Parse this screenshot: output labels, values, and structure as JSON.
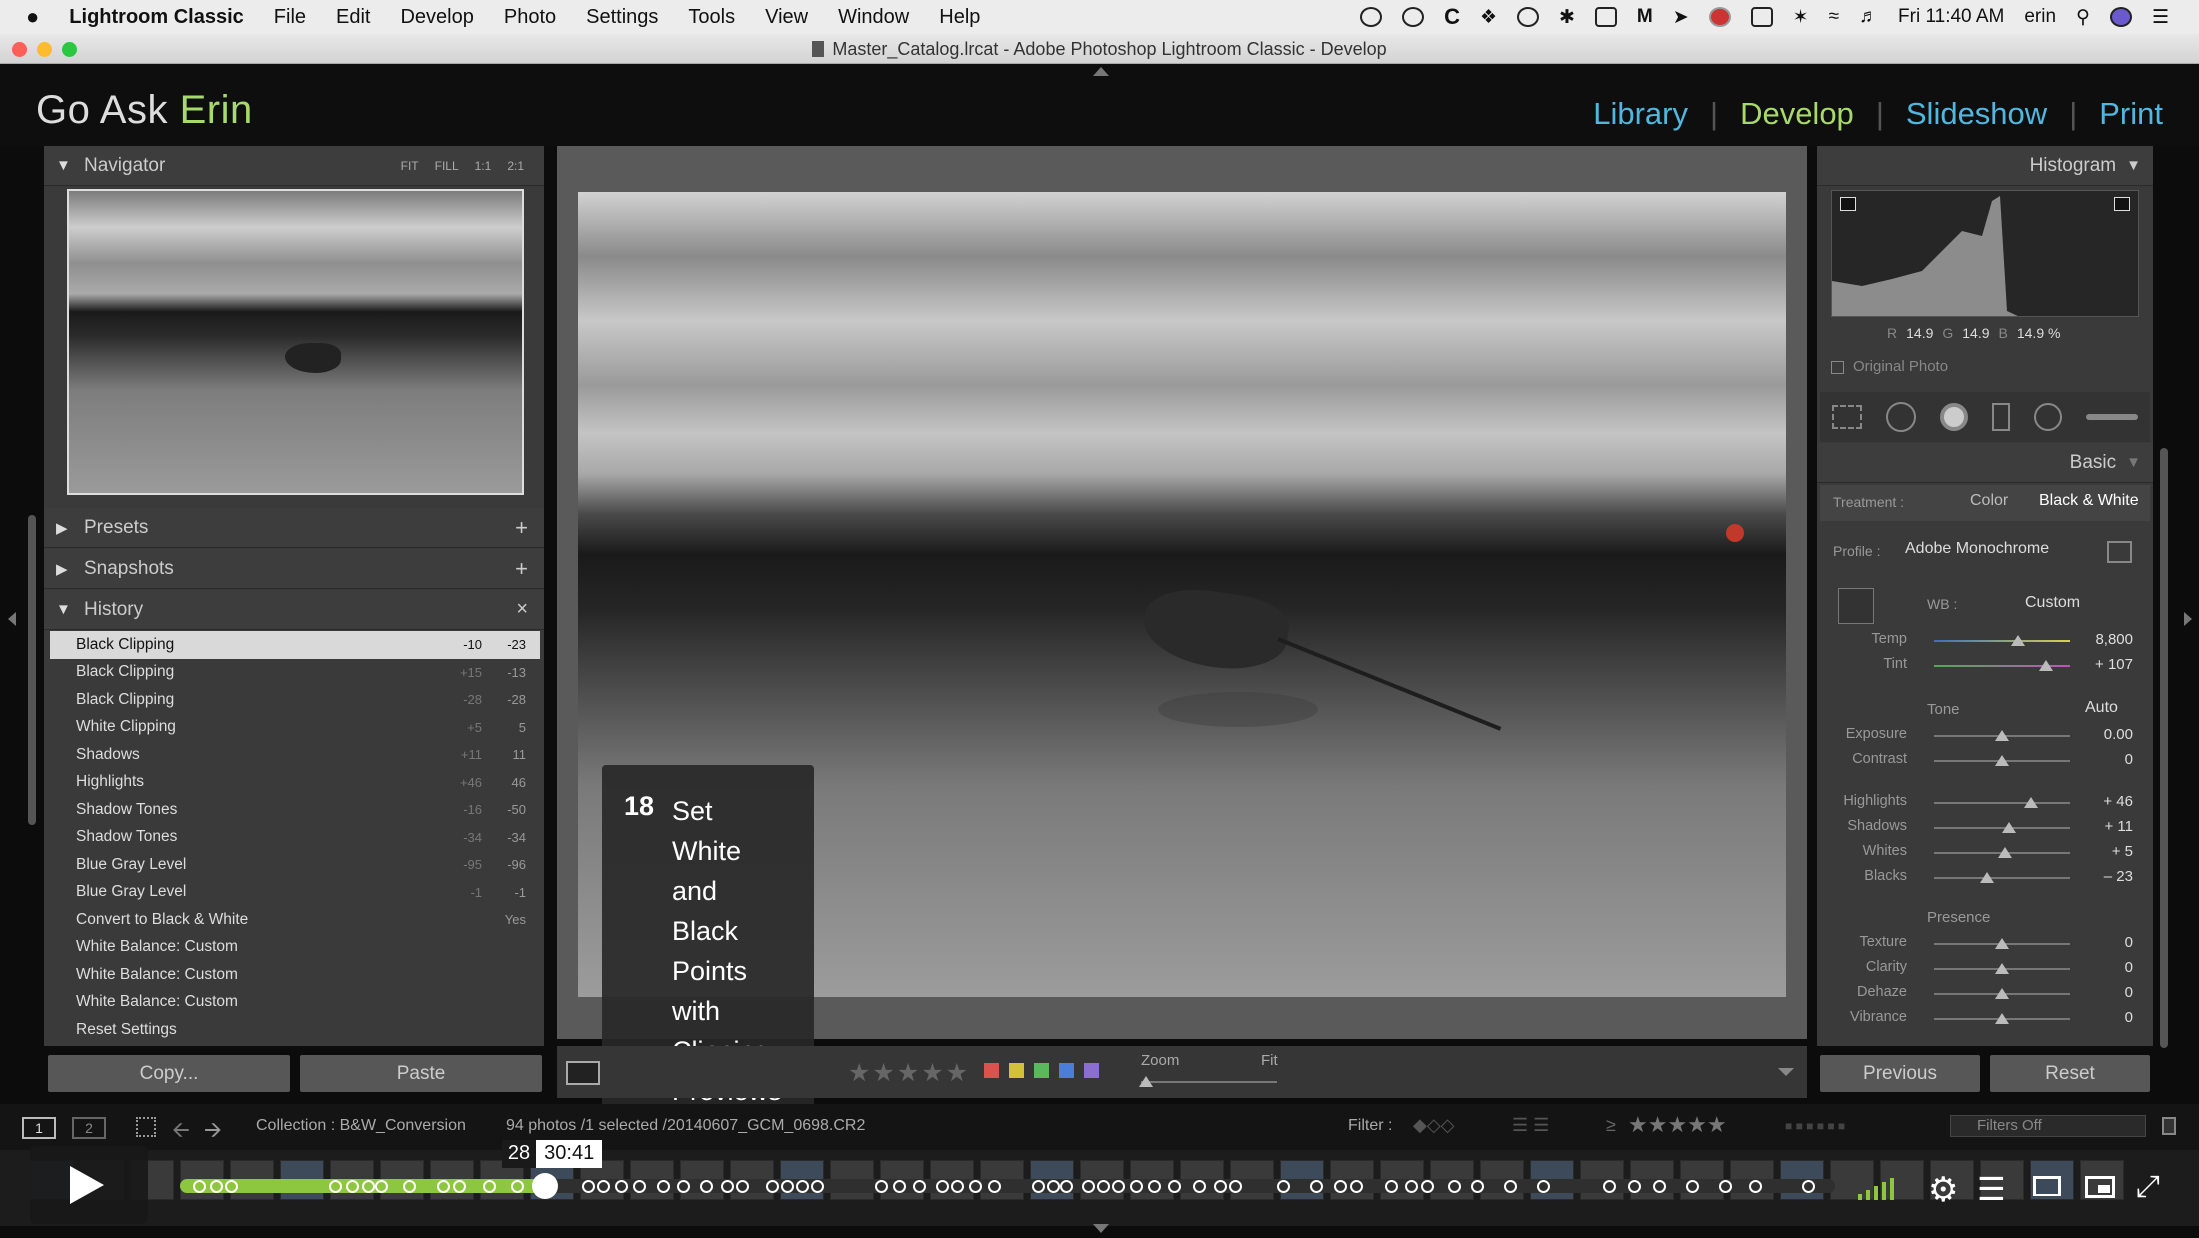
{
  "menubar": {
    "apple": "",
    "app_name": "Lightroom Classic",
    "menus": [
      "File",
      "Edit",
      "Develop",
      "Photo",
      "Settings",
      "Tools",
      "View",
      "Window",
      "Help"
    ],
    "clock": "Fri 11:40 AM",
    "user": "erin"
  },
  "window": {
    "title": "Master_Catalog.lrcat - Adobe Photoshop Lightroom Classic - Develop"
  },
  "brand": {
    "prefix": "Go Ask ",
    "highlight": "Erin"
  },
  "modules": [
    {
      "label": "Library",
      "color": "#4fb7e0"
    },
    {
      "label": "Develop",
      "color": "#a7d96b"
    },
    {
      "label": "Slideshow",
      "color": "#4fb7e0"
    },
    {
      "label": "Print",
      "color": "#4fb7e0"
    }
  ],
  "navigator": {
    "title": "Navigator",
    "zoom_options": [
      "FIT",
      "FILL",
      "1:1",
      "2:1"
    ]
  },
  "presets": {
    "title": "Presets"
  },
  "snapshots": {
    "title": "Snapshots"
  },
  "history": {
    "title": "History",
    "items": [
      {
        "label": "Black Clipping",
        "v1": "-10",
        "v2": "-23",
        "selected": true
      },
      {
        "label": "Black Clipping",
        "v1": "+15",
        "v2": "-13"
      },
      {
        "label": "Black Clipping",
        "v1": "-28",
        "v2": "-28"
      },
      {
        "label": "White Clipping",
        "v1": "+5",
        "v2": "5"
      },
      {
        "label": "Shadows",
        "v1": "+11",
        "v2": "11"
      },
      {
        "label": "Highlights",
        "v1": "+46",
        "v2": "46"
      },
      {
        "label": "Shadow Tones",
        "v1": "-16",
        "v2": "-50"
      },
      {
        "label": "Shadow Tones",
        "v1": "-34",
        "v2": "-34"
      },
      {
        "label": "Blue Gray Level",
        "v1": "-95",
        "v2": "-96"
      },
      {
        "label": "Blue Gray Level",
        "v1": "-1",
        "v2": "-1"
      },
      {
        "label": "Convert to Black & White",
        "v1": "",
        "v2": "Yes"
      },
      {
        "label": "White Balance: Custom",
        "v1": "",
        "v2": ""
      },
      {
        "label": "White Balance: Custom",
        "v1": "",
        "v2": ""
      },
      {
        "label": "White Balance: Custom",
        "v1": "",
        "v2": ""
      },
      {
        "label": "Reset Settings",
        "v1": "",
        "v2": ""
      }
    ]
  },
  "left_buttons": {
    "copy": "Copy...",
    "paste": "Paste"
  },
  "caption": {
    "number": "18",
    "lines": [
      "Set",
      "White",
      "and",
      "Black",
      "Points",
      "with",
      "Clipping",
      "Previews"
    ]
  },
  "toolbar": {
    "zoom_label": "Zoom",
    "fit_label": "Fit"
  },
  "histogram": {
    "title": "Histogram",
    "r_label": "R",
    "r": "14.9",
    "g_label": "G",
    "g": "14.9",
    "b_label": "B",
    "b": "14.9 %",
    "original_photo": "Original Photo"
  },
  "basic": {
    "title": "Basic",
    "treatment_label": "Treatment :",
    "treatment_color": "Color",
    "treatment_bw": "Black & White",
    "profile_label": "Profile :",
    "profile_value": "Adobe Monochrome",
    "wb_label": "WB :",
    "wb_value": "Custom",
    "temp": {
      "label": "Temp",
      "value": "8,800",
      "pos": 0.62
    },
    "tint": {
      "label": "Tint",
      "value": "+ 107",
      "pos": 0.82
    },
    "tone_label": "Tone",
    "auto_label": "Auto",
    "tone": [
      {
        "label": "Exposure",
        "value": "0.00",
        "pos": 0.5
      },
      {
        "label": "Contrast",
        "value": "0",
        "pos": 0.5
      }
    ],
    "tone2": [
      {
        "label": "Highlights",
        "value": "+ 46",
        "pos": 0.71
      },
      {
        "label": "Shadows",
        "value": "+ 11",
        "pos": 0.55
      },
      {
        "label": "Whites",
        "value": "+ 5",
        "pos": 0.52
      },
      {
        "label": "Blacks",
        "value": "– 23",
        "pos": 0.39
      }
    ],
    "presence_label": "Presence",
    "presence": [
      {
        "label": "Texture",
        "value": "0",
        "pos": 0.5
      },
      {
        "label": "Clarity",
        "value": "0",
        "pos": 0.5
      },
      {
        "label": "Dehaze",
        "value": "0",
        "pos": 0.5
      },
      {
        "label": "Vibrance",
        "value": "0",
        "pos": 0.5
      }
    ]
  },
  "right_buttons": {
    "previous": "Previous",
    "reset": "Reset"
  },
  "filmstrip": {
    "page1": "1",
    "page2": "2",
    "collection": "Collection : B&W_Conversion",
    "photos": "94 photos /1 selected /20140607_GCM_0698.CR2",
    "filter_label": "Filter :",
    "filters_off": "Filters Off",
    "gte": "≥"
  },
  "video": {
    "chapter": "28",
    "time": "30:41",
    "progress": 0.2205
  }
}
